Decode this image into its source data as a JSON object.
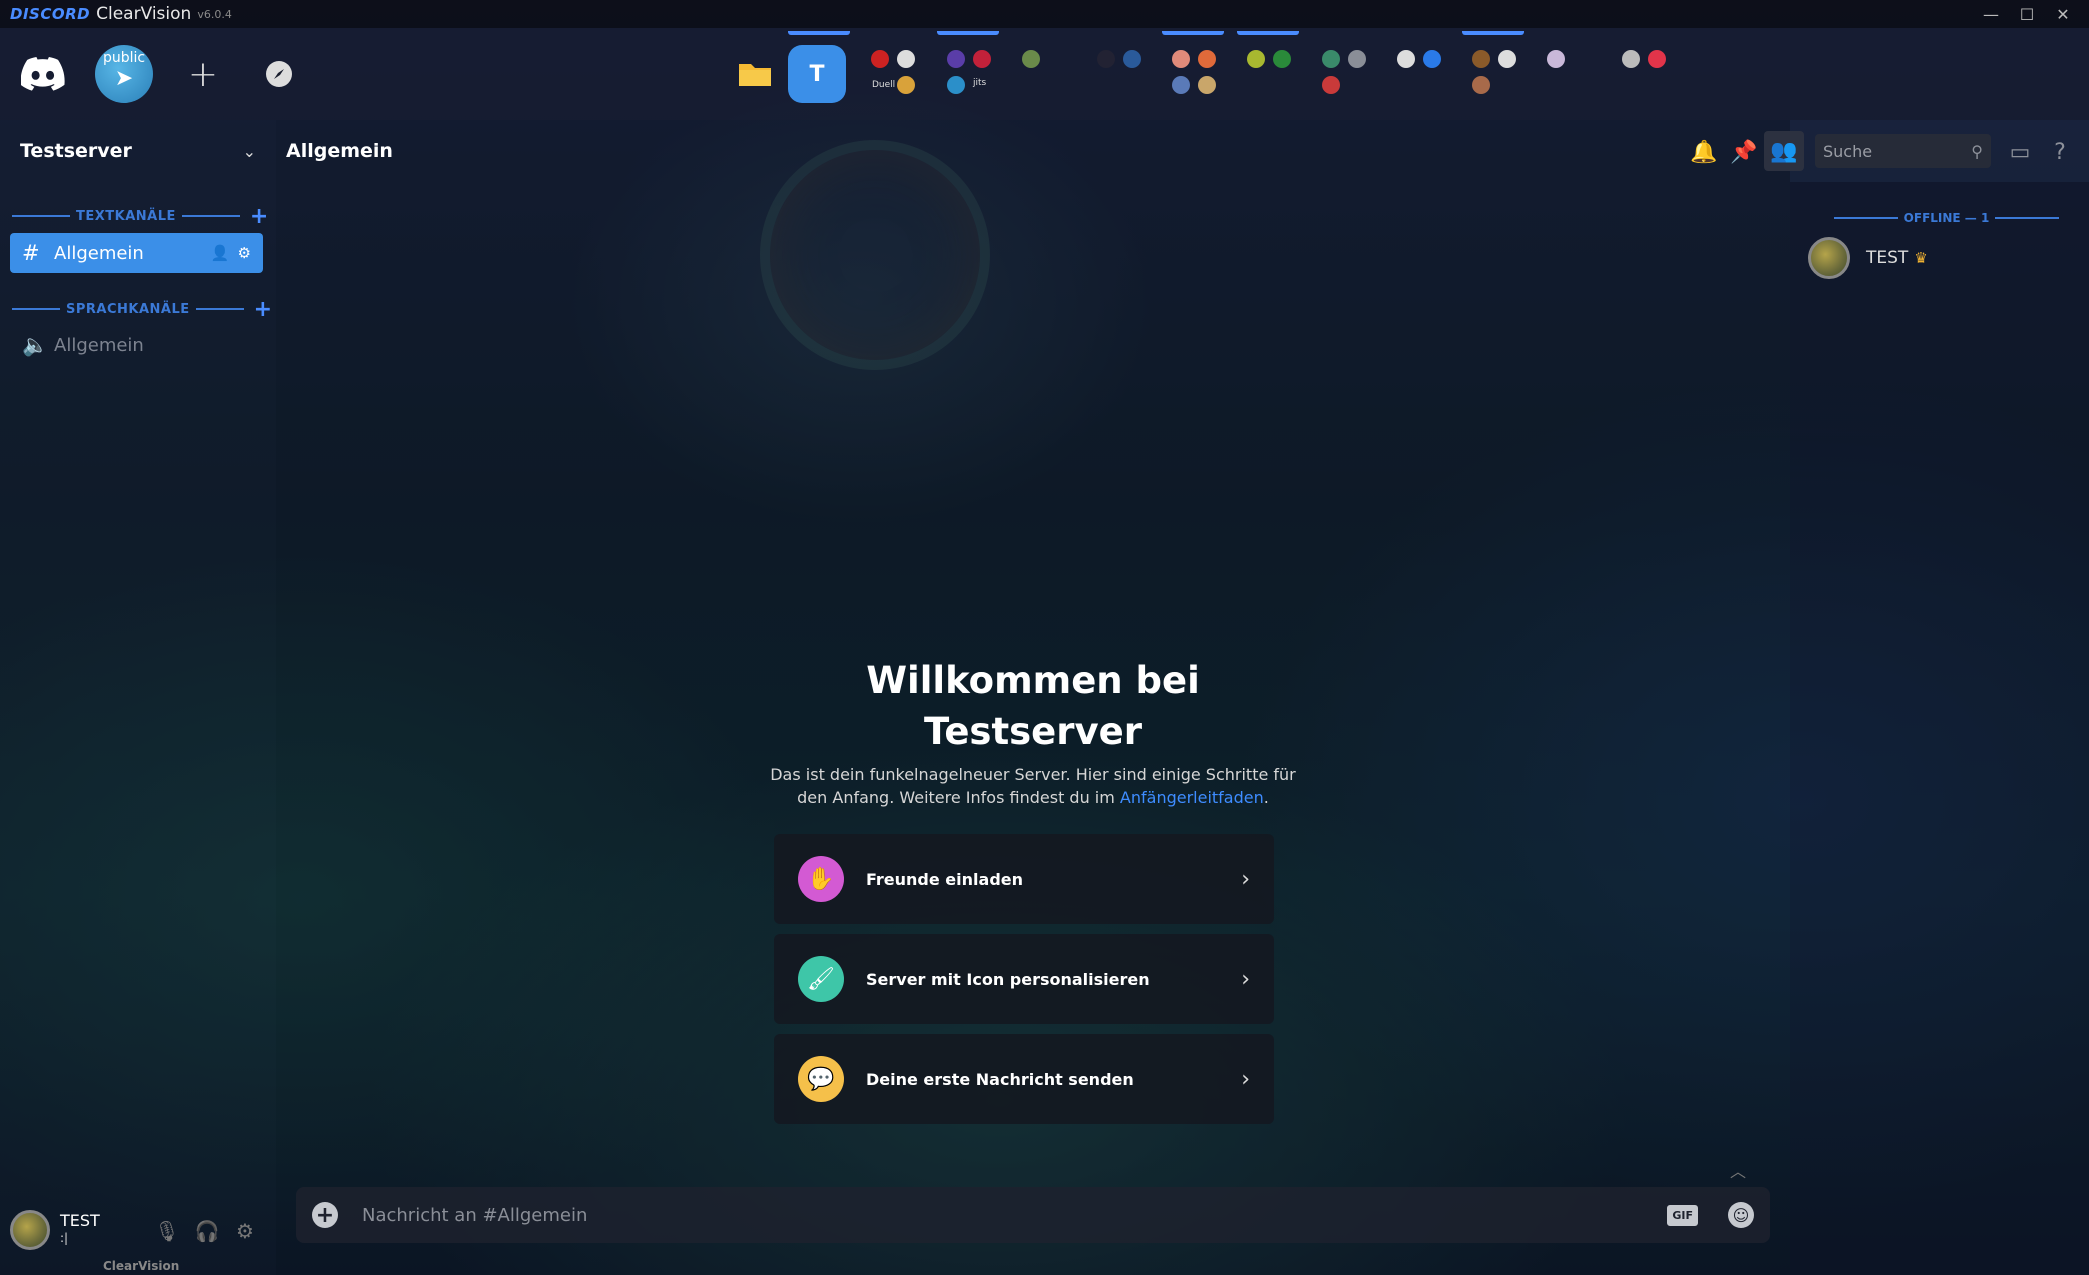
{
  "titlebar": {
    "brand": "DISCORD",
    "app_name": "ClearVision",
    "version": "v6.0.4",
    "controls": [
      "—",
      "☐",
      "✕"
    ]
  },
  "serverbar": {
    "public_label": "public",
    "active_server_letter": "T",
    "mini_labels": [
      "Duell",
      "jits"
    ]
  },
  "sidebar": {
    "server_name": "Testserver",
    "text_category": "TEXTKANÄLE",
    "voice_category": "SPRACHKANÄLE",
    "text_channels": [
      {
        "name": "Allgemein"
      }
    ],
    "voice_channels": [
      {
        "name": "Allgemein"
      }
    ]
  },
  "user": {
    "name": "TEST",
    "status": ":|",
    "watermark": "ClearVision"
  },
  "header": {
    "channel": "Allgemein",
    "search_placeholder": "Suche"
  },
  "welcome": {
    "title_line1": "Willkommen bei",
    "title_line2": "Testserver",
    "desc_line1": "Das ist dein funkelnagelneuer Server. Hier sind einige Schritte für",
    "desc_line2_prefix": "den Anfang. Weitere Infos findest du im ",
    "desc_link": "Anfängerleitfaden",
    "desc_suffix": ".",
    "cards": [
      {
        "label": "Freunde einladen",
        "color": "#d35ad3"
      },
      {
        "label": "Server mit Icon personalisieren",
        "color": "#3ec6a8"
      },
      {
        "label": "Deine erste Nachricht senden",
        "color": "#f5c04a"
      }
    ]
  },
  "composer": {
    "placeholder": "Nachricht an #Allgemein",
    "gif_label": "GIF"
  },
  "members": {
    "category": "OFFLINE — 1",
    "list": [
      {
        "name": "TEST",
        "owner": true
      }
    ]
  },
  "colors": {
    "accent": "#3b8fe8",
    "category": "#3b79d6",
    "link": "#3e8cff",
    "crown": "#f0b232"
  }
}
